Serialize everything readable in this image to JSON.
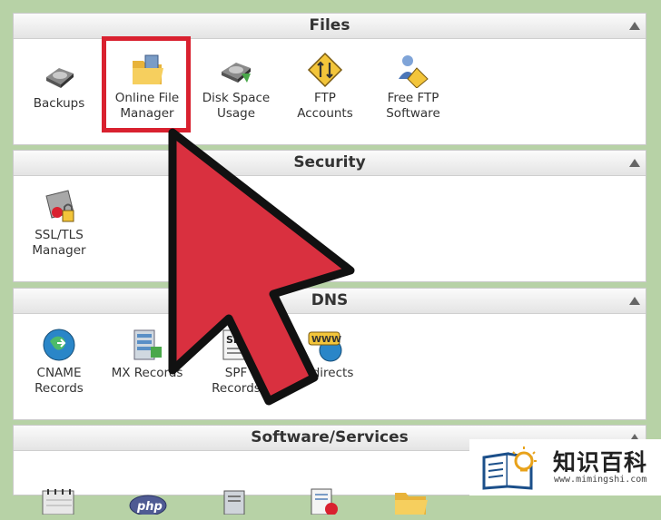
{
  "sections": [
    {
      "title": "Files",
      "items": [
        {
          "label": "Backups",
          "icon": "backup-disk-icon"
        },
        {
          "label": "Online File\nManager",
          "icon": "folder-file-manager-icon"
        },
        {
          "label": "Disk Space\nUsage",
          "icon": "disk-space-icon"
        },
        {
          "label": "FTP\nAccounts",
          "icon": "ftp-accounts-icon"
        },
        {
          "label": "Free FTP\nSoftware",
          "icon": "free-ftp-software-icon"
        }
      ]
    },
    {
      "title": "Security",
      "items": [
        {
          "label": "SSL/TLS\nManager",
          "icon": "ssl-certificate-icon"
        }
      ]
    },
    {
      "title": "DNS",
      "items": [
        {
          "label": "CNAME\nRecords",
          "icon": "globe-icon"
        },
        {
          "label": "MX Records",
          "icon": "mx-records-icon"
        },
        {
          "label": "SPF\nRecords",
          "icon": "spf-icon"
        },
        {
          "label": "Redirects",
          "icon": "www-redirect-icon"
        }
      ]
    },
    {
      "title": "Software/Services",
      "items": []
    }
  ],
  "watermark": {
    "title": "知识百科",
    "url": "www.mimingshi.com"
  },
  "colors": {
    "highlight": "#d9212f",
    "arrow": "#d9303f",
    "background": "#b7d2a6"
  }
}
